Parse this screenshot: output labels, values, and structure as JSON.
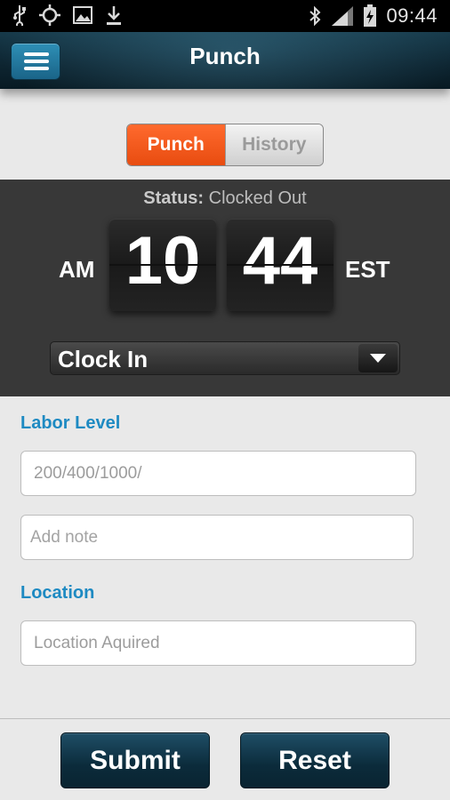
{
  "status_bar": {
    "time": "09:44",
    "icons": [
      "usb-icon",
      "gps-icon",
      "image-icon",
      "download-icon",
      "bluetooth-icon",
      "signal-icon",
      "battery-charging-icon"
    ]
  },
  "header": {
    "title": "Punch",
    "menu_icon": "hamburger-icon"
  },
  "tabs": [
    {
      "label": "Punch",
      "active": true
    },
    {
      "label": "History",
      "active": false
    }
  ],
  "clock_panel": {
    "status_label": "Status:",
    "status_value": "Clocked Out",
    "meridiem": "AM",
    "hour": "10",
    "minute": "44",
    "timezone": "EST",
    "punch_type": "Clock In"
  },
  "form": {
    "labor_level_label": "Labor Level",
    "labor_level_value": "200/400/1000/",
    "note_placeholder": "Add note",
    "location_label": "Location",
    "location_value": "Location Aquired"
  },
  "actions": {
    "submit_label": "Submit",
    "reset_label": "Reset"
  },
  "colors": {
    "accent": "#1e8ac2",
    "active_tab": "#f2571b",
    "header": "#0d2430",
    "panel": "#383838"
  }
}
